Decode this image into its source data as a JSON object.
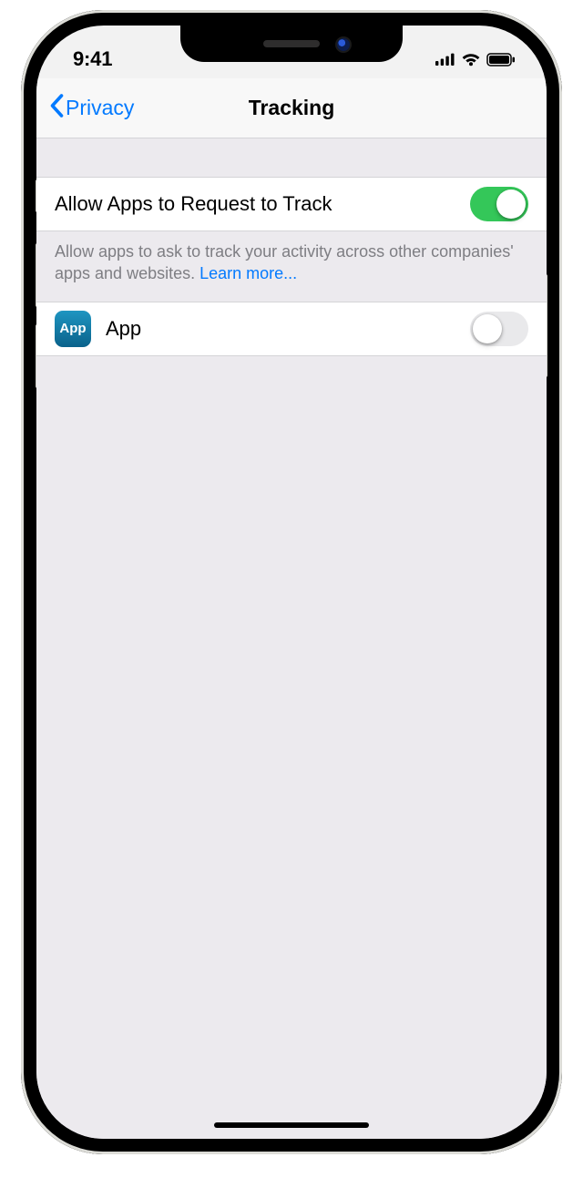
{
  "status": {
    "time": "9:41"
  },
  "nav": {
    "back_label": "Privacy",
    "title": "Tracking"
  },
  "main_toggle": {
    "label": "Allow Apps to Request to Track",
    "on": true
  },
  "footer": {
    "text": "Allow apps to ask to track your activity across other companies' apps and websites. ",
    "learn_more": "Learn more..."
  },
  "apps": [
    {
      "icon_label": "App",
      "name": "App",
      "tracking_on": false
    }
  ]
}
